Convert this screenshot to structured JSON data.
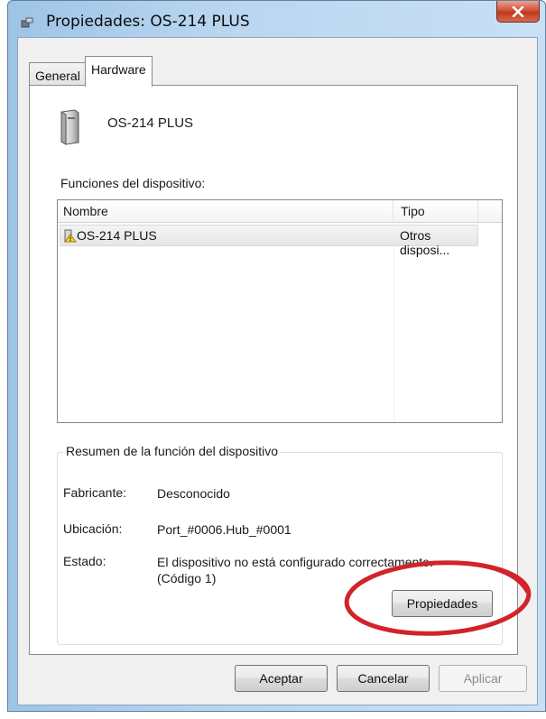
{
  "window": {
    "title": "Propiedades: OS-214 PLUS"
  },
  "tabs": [
    {
      "label": "General",
      "selected": false
    },
    {
      "label": "Hardware",
      "selected": true
    }
  ],
  "device": {
    "name": "OS-214 PLUS",
    "icon": "usb-device-icon"
  },
  "functions": {
    "label": "Funciones del dispositivo:",
    "columns": [
      "Nombre",
      "Tipo"
    ],
    "rows": [
      {
        "name": "OS-214 PLUS",
        "type": "Otros disposi...",
        "icon": "warning-device-icon"
      }
    ]
  },
  "summary": {
    "title": "Resumen de la función del dispositivo",
    "fields": [
      {
        "label": "Fabricante:",
        "value": "Desconocido"
      },
      {
        "label": "Ubicación:",
        "value": "Port_#0006.Hub_#0001"
      },
      {
        "label": "Estado:",
        "value": "El dispositivo no está configurado correctamente.",
        "value2": "(Código 1)"
      }
    ],
    "properties_button": "Propiedades"
  },
  "footer": {
    "ok": "Aceptar",
    "cancel": "Cancelar",
    "apply": "Aplicar"
  },
  "colors": {
    "highlight": "#d2232a"
  }
}
